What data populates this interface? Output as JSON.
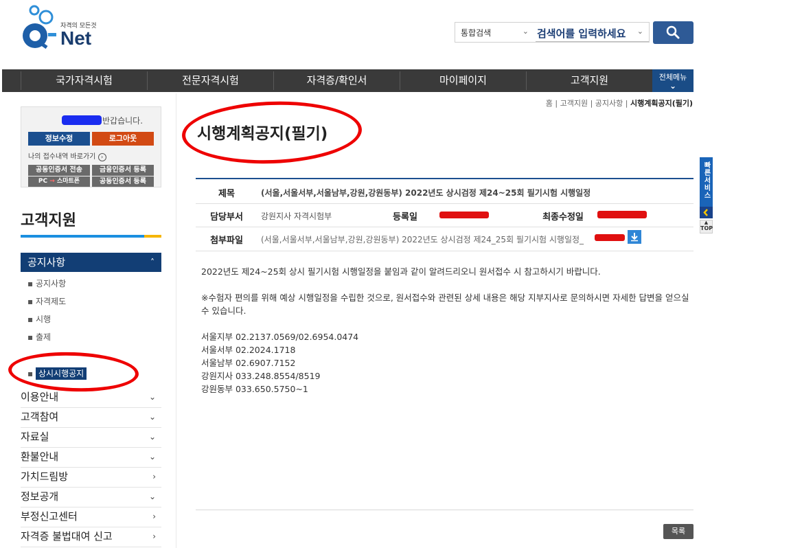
{
  "brand": {
    "tagline": "자격의 모든것",
    "name": "Net",
    "q": "Q"
  },
  "search": {
    "scope": "통합검색",
    "placeholder": "검색어를 입력하세요"
  },
  "nav": {
    "items": [
      "국가자격시험",
      "전문자격시험",
      "자격증/확인서",
      "마이페이지",
      "고객지원"
    ],
    "all_menu": "전체메뉴"
  },
  "login": {
    "greeting": "반갑습니다.",
    "edit_info": "정보수정",
    "logout": "로그아웃",
    "history_link": "나의 접수내역 바로가기",
    "cert_transfer": "공동인증서 전송",
    "finance_cert": "금융인증서 등록",
    "pc": "PC",
    "smartphone": "스마트폰",
    "joint_cert": "공동인증서 등록"
  },
  "sidebar": {
    "title": "고객지원",
    "section": "공지사항",
    "sub_items": [
      "공지사항",
      "자격제도",
      "시행",
      "출제",
      "상시시행공지"
    ],
    "menu": [
      {
        "label": "이용안내",
        "arrow": "⌄"
      },
      {
        "label": "고객참여",
        "arrow": "⌄"
      },
      {
        "label": "자료실",
        "arrow": "⌄"
      },
      {
        "label": "환불안내",
        "arrow": "⌄"
      },
      {
        "label": "가치드림방",
        "arrow": "›"
      },
      {
        "label": "정보공개",
        "arrow": "⌄"
      },
      {
        "label": "부정신고센터",
        "arrow": "›"
      },
      {
        "label": "자격증 불법대여 신고",
        "arrow": "›"
      }
    ]
  },
  "breadcrumb": {
    "home": "홈",
    "level1": "고객지원",
    "level2": "공지사항",
    "current": "시행계획공지(필기)"
  },
  "page": {
    "title": "시행계획공지(필기)"
  },
  "detail": {
    "subject_label": "제목",
    "subject": "(서울,서울서부,서울남부,강원,강원동부) 2022년도 상시검정 제24~25회 필기시험 시행일정",
    "dept_label": "담당부서",
    "dept": "강원지사 자격시험부",
    "reg_label": "등록일",
    "mod_label": "최종수정일",
    "attach_label": "첨부파일",
    "attach": "(서울,서울서부,서울남부,강원,강원동부) 2022년도 상시검정 제24_25회 필기시험 시행일정_"
  },
  "body": {
    "p1": "2022년도 제24~25회 상시 필기시험 시행일정을 붙임과 같이 알려드리오니 원서접수 시 참고하시기 바랍니다.",
    "p2": "※수험자 편의를 위해 예상 시행일정을 수립한 것으로, 원서접수와 관련된 상세 내용은 해당 지부지사로 문의하시면 자세한 답변을 얻으실 수 있습니다.",
    "contacts": [
      "서울지부 02.2137.0569/02.6954.0474",
      "서울서부 02.2024.1718",
      "서울남부 02.6907.7152",
      "강원지사 033.248.8554/8519",
      "강원동부 033.650.5750~1"
    ]
  },
  "list_button": "목록",
  "quick": {
    "label": "빠른서비스",
    "top": "TOP"
  },
  "colors": {
    "nav_bg": "#3a3a3a",
    "primary": "#1b4f8f",
    "accent_orange": "#d24a14",
    "annotation_red": "#ee0000"
  }
}
